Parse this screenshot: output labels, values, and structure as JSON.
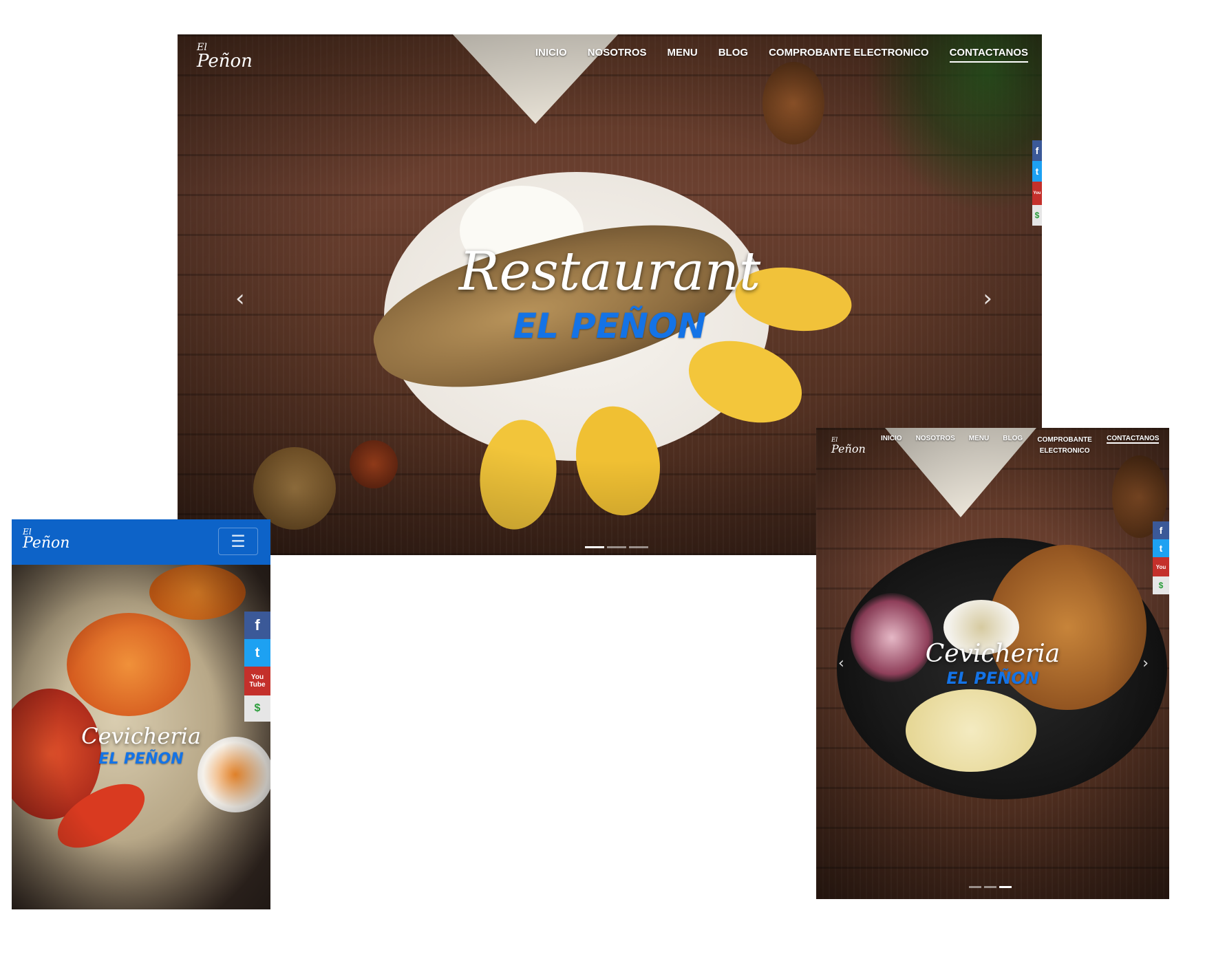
{
  "desktop": {
    "logo": {
      "top": "El",
      "main": "Peñon"
    },
    "nav": [
      "INICIO",
      "NOSOTROS",
      "MENU",
      "BLOG",
      "COMPROBANTE ELECTRONICO",
      "CONTACTANOS"
    ],
    "active_nav": "CONTACTANOS",
    "hero_title": "Restaurant",
    "hero_subtitle": "EL PEÑON",
    "prev_glyph": "‹",
    "next_glyph": "›",
    "slides": 3,
    "active_slide": 1
  },
  "tablet": {
    "logo": {
      "top": "El",
      "main": "Peñon"
    },
    "nav": [
      "INICIO",
      "NOSOTROS",
      "MENU",
      "BLOG",
      "COMPROBANTE ELECTRONICO",
      "CONTACTANOS"
    ],
    "active_nav": "CONTACTANOS",
    "hero_title": "Cevicheria",
    "hero_subtitle": "EL PEÑON",
    "prev_glyph": "‹",
    "next_glyph": "›",
    "slides": 3,
    "active_slide": 3
  },
  "mobile": {
    "logo": {
      "top": "El",
      "main": "Peñon"
    },
    "menu_toggle_glyph": "☰",
    "hero_title": "Cevicheria",
    "hero_subtitle": "EL PEÑON",
    "header_color": "#0d63c8"
  },
  "social": {
    "facebook": "f",
    "twitter": "t",
    "youtube_top": "You",
    "youtube_bottom": "Tube",
    "payment": "$"
  },
  "colors": {
    "accent_blue": "#1473e6",
    "wood": "#5a3524"
  }
}
